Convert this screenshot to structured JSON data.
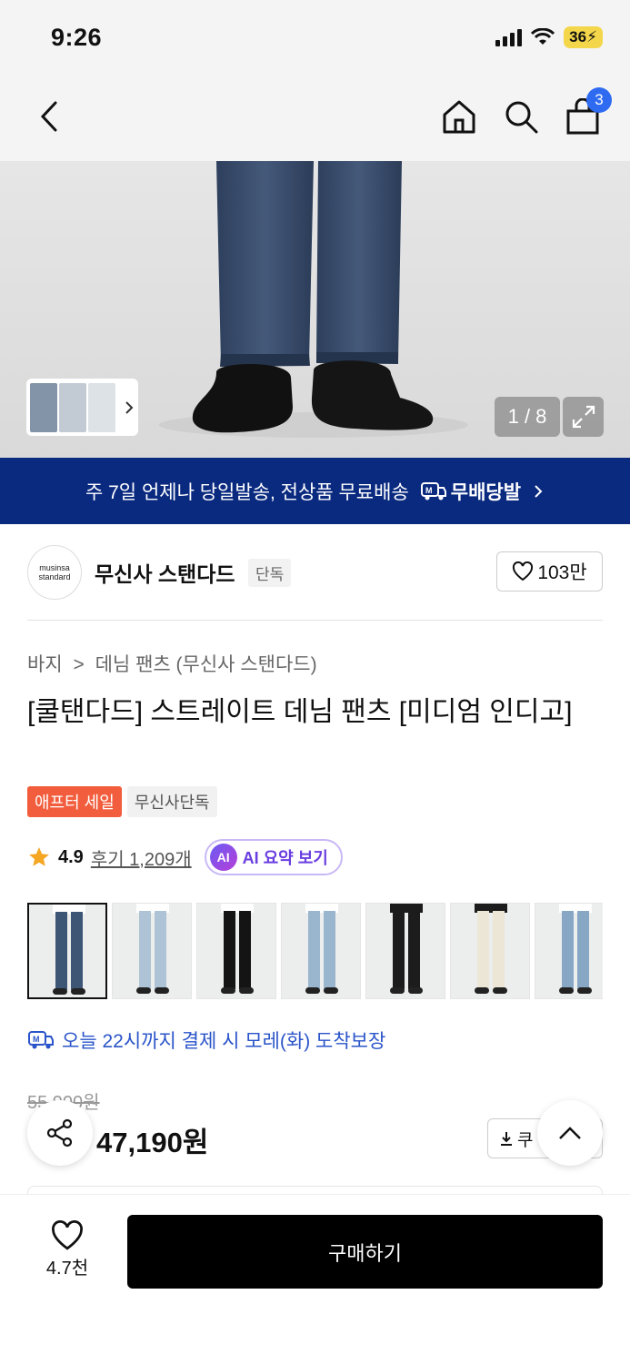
{
  "status_bar": {
    "time": "9:26",
    "battery": "36"
  },
  "nav": {
    "back_icon": "chevron-left-icon",
    "cart_count": "3"
  },
  "hero": {
    "counter": "1 / 8"
  },
  "banner": {
    "text": "주 7일 언제나 당일발송, 전상품 무료배송",
    "brand": "무배당발"
  },
  "brand": {
    "logo_line1": "musinsa",
    "logo_line2": "standard",
    "name": "무신사 스탠다드",
    "tag": "단독",
    "likes": "103만"
  },
  "product": {
    "breadcrumb_1": "바지",
    "breadcrumb_sep": ">",
    "breadcrumb_2": "데님 팬츠 (무신사 스탠다드)",
    "title": "[쿨탠다드] 스트레이트 데님 팬츠 [미디엄 인디고]",
    "badge_sale": "애프터 세일",
    "badge_exclusive": "무신사단독",
    "rating": "4.9",
    "reviews": "후기 1,209개",
    "ai_badge": "AI",
    "ai_summary": "AI 요약 보기",
    "delivery": "오늘 22시까지 결제 시 모레(화) 도착보장",
    "original_price": "55,900원",
    "sale_price": "47,190원",
    "coupon": "쿠"
  },
  "variants": [
    {
      "pants": "#3e5676",
      "top": "#ffffff",
      "selected": true
    },
    {
      "pants": "#aec3d6",
      "top": "#ffffff",
      "selected": false
    },
    {
      "pants": "#141414",
      "top": "#ffffff",
      "selected": false
    },
    {
      "pants": "#9ab6cf",
      "top": "#ffffff",
      "selected": false
    },
    {
      "pants": "#1c1c1c",
      "top": "#1c1c1c",
      "selected": false
    },
    {
      "pants": "#ece6d6",
      "top": "#1c1c1c",
      "selected": false
    },
    {
      "pants": "#88a7c4",
      "top": "#ffffff",
      "selected": false
    }
  ],
  "bottom_bar": {
    "wish_count": "4.7천",
    "buy_label": "구매하기"
  },
  "colors": {
    "banner_bg": "#0a2a80",
    "accent_blue": "#2f6bf1",
    "sale_badge": "#f25e3d",
    "ai_purple": "#6a3ee0"
  }
}
